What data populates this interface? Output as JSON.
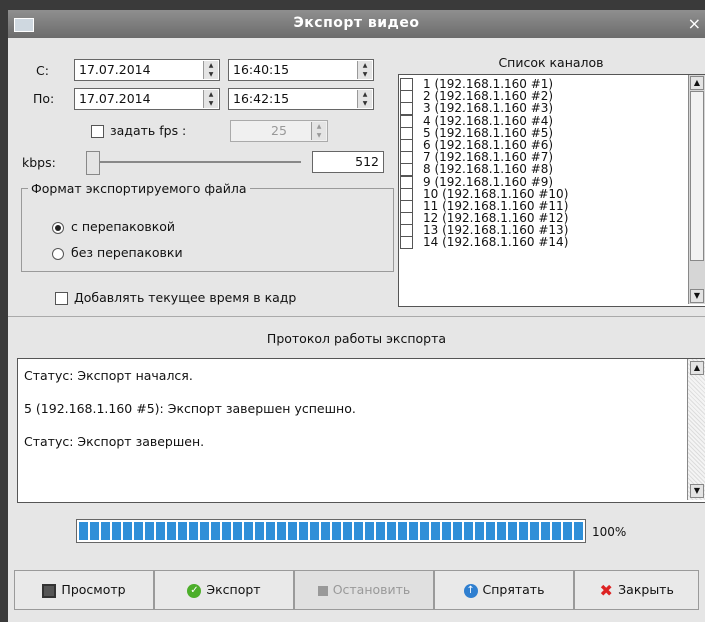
{
  "window": {
    "title": "Экспорт видео",
    "close": "×"
  },
  "from": {
    "label": "С:",
    "date": "17.07.2014",
    "time": "16:40:15"
  },
  "to": {
    "label": "По:",
    "date": "17.07.2014",
    "time": "16:42:15"
  },
  "fps": {
    "label": "задать fps :",
    "checked": false,
    "value": "25"
  },
  "kbps": {
    "label": "kbps:",
    "value": "512"
  },
  "format": {
    "title": "Формат экспортируемого файла",
    "options": [
      "с перепаковкой",
      "без перепаковки"
    ],
    "selected": 0
  },
  "add_time": {
    "label": "Добавлять текущее время в кадр",
    "checked": false
  },
  "channels": {
    "title": "Список каналов",
    "items": [
      "1 (192.168.1.160 #1)",
      "2 (192.168.1.160 #2)",
      "3 (192.168.1.160 #3)",
      "4 (192.168.1.160 #4)",
      "5 (192.168.1.160 #5)",
      "6 (192.168.1.160 #6)",
      "7 (192.168.1.160 #7)",
      "8 (192.168.1.160 #8)",
      "9 (192.168.1.160 #9)",
      "10 (192.168.1.160 #10)",
      "11 (192.168.1.160 #11)",
      "12 (192.168.1.160 #12)",
      "13 (192.168.1.160 #13)",
      "14 (192.168.1.160 #14)"
    ]
  },
  "log": {
    "title": "Протокол работы экспорта",
    "lines": [
      "Статус: Экспорт начался.",
      "5 (192.168.1.160 #5): Экспорт завершен успешно.",
      "Статус: Экспорт завершен."
    ]
  },
  "progress": {
    "value": 1.0,
    "label": "100%",
    "color": "#2f8fd8"
  },
  "buttons": {
    "preview": "Просмотр",
    "export": "Экспорт",
    "stop": "Остановить",
    "hide": "Спрятать",
    "close": "Закрыть"
  }
}
